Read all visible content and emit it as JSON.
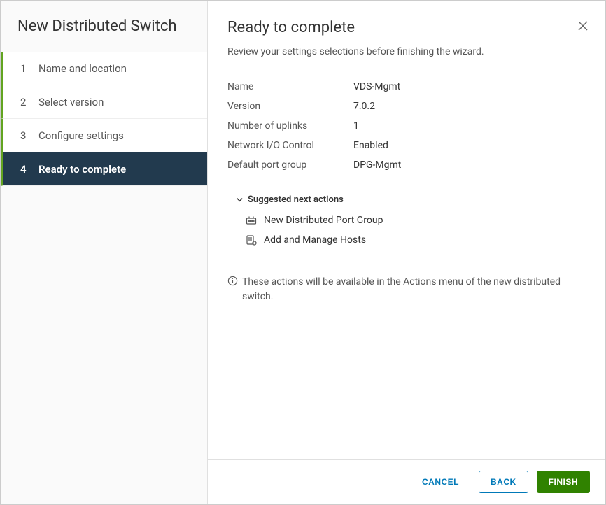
{
  "wizard": {
    "title": "New Distributed Switch",
    "steps": [
      {
        "num": "1",
        "label": "Name and location",
        "state": "completed"
      },
      {
        "num": "2",
        "label": "Select version",
        "state": "completed"
      },
      {
        "num": "3",
        "label": "Configure settings",
        "state": "completed"
      },
      {
        "num": "4",
        "label": "Ready to complete",
        "state": "active"
      }
    ]
  },
  "page": {
    "title": "Ready to complete",
    "subtitle": "Review your settings selections before finishing the wizard."
  },
  "summary": [
    {
      "label": "Name",
      "value": "VDS-Mgmt"
    },
    {
      "label": "Version",
      "value": "7.0.2"
    },
    {
      "label": "Number of uplinks",
      "value": "1"
    },
    {
      "label": "Network I/O Control",
      "value": "Enabled"
    },
    {
      "label": "Default port group",
      "value": "DPG-Mgmt"
    }
  ],
  "nextActions": {
    "header": "Suggested next actions",
    "items": [
      {
        "icon": "portgroup-icon",
        "label": "New Distributed Port Group"
      },
      {
        "icon": "hosts-icon",
        "label": "Add and Manage Hosts"
      }
    ]
  },
  "infoNote": "These actions will be available in the Actions menu of the new distributed switch.",
  "buttons": {
    "cancel": "CANCEL",
    "back": "BACK",
    "finish": "FINISH"
  }
}
